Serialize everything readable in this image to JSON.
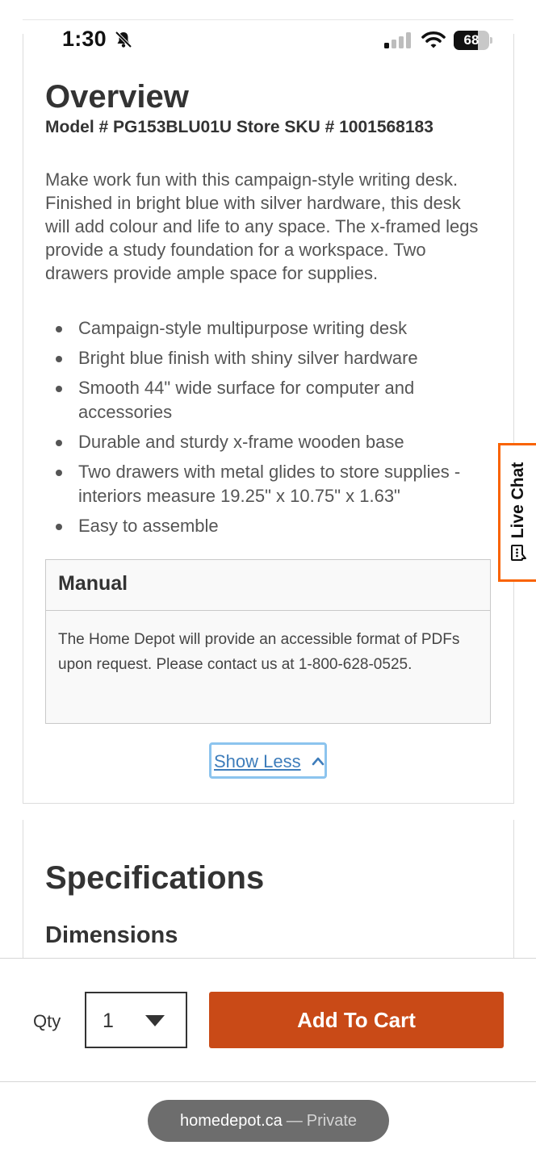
{
  "status_bar": {
    "time": "1:30",
    "battery": "68",
    "battery_level": 0.68,
    "icons": [
      "bell-slash-icon",
      "cellular-signal-icon",
      "wifi-icon",
      "battery-icon"
    ]
  },
  "overview": {
    "title": "Overview",
    "model_line": "Model # PG153BLU01U Store SKU # 1001568183",
    "description": "Make work fun with this campaign-style writing desk. Finished in bright blue with silver hardware, this desk will add colour and life to any space. The x-framed legs provide a study foundation for a workspace. Two drawers provide ample space for supplies.",
    "features": [
      "Campaign-style multipurpose writing desk",
      "Bright blue finish with shiny silver hardware",
      "Smooth 44\" wide surface for computer and accessories",
      "Durable and sturdy x-frame wooden base",
      "Two drawers with metal glides to store supplies - interiors measure 19.25\" x 10.75\" x 1.63\"",
      "Easy to assemble"
    ],
    "manual": {
      "title": "Manual",
      "body": "The Home Depot will provide an accessible format of PDFs upon request. Please contact us at 1-800-628-0525."
    },
    "show_less_label": "Show Less"
  },
  "live_chat": {
    "label": "Live Chat",
    "accent_color": "#f96302"
  },
  "specifications": {
    "title": "Specifications",
    "dimensions_title": "Dimensions"
  },
  "purchase_bar": {
    "qty_label": "Qty",
    "qty_value": "1",
    "add_to_cart_label": "Add To Cart",
    "button_color": "#c94a17"
  },
  "browser": {
    "domain": "homedepot.ca",
    "separator": "—",
    "mode": "Private"
  }
}
